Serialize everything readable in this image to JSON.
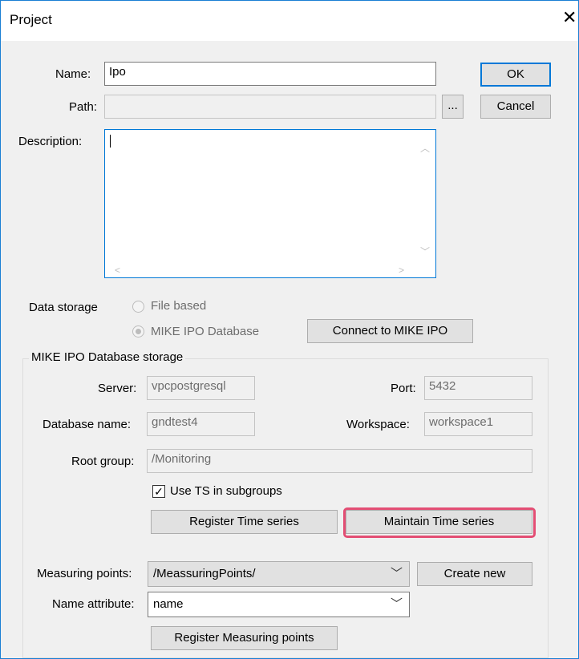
{
  "window": {
    "title": "Project",
    "close_glyph": "✕"
  },
  "fields": {
    "name_label": "Name:",
    "name_value": "Ipo",
    "path_label": "Path:",
    "path_value": "",
    "browse_label": "...",
    "description_label": "Description:",
    "description_value": ""
  },
  "buttons": {
    "ok": "OK",
    "cancel": "Cancel",
    "connect": "Connect to  MIKE IPO"
  },
  "storage": {
    "label": "Data storage",
    "option_file": "File based",
    "option_db": "MIKE IPO Database"
  },
  "db_group": {
    "title": "MIKE IPO Database storage",
    "server_label": "Server:",
    "server_value": "vpcpostgresql",
    "port_label": "Port:",
    "port_value": "5432",
    "dbname_label": "Database name:",
    "dbname_value": "gndtest4",
    "workspace_label": "Workspace:",
    "workspace_value": "workspace1",
    "root_label": "Root group:",
    "root_value": "/Monitoring",
    "use_ts_label": "Use TS in subgroups",
    "use_ts_checked": true,
    "register_ts": "Register Time series",
    "maintain_ts": "Maintain Time series",
    "measuring_label": "Measuring points:",
    "measuring_value": "/MeassuringPoints/",
    "create_new": "Create new",
    "name_attr_label": "Name attribute:",
    "name_attr_value": "name",
    "register_mp": "Register Measuring points"
  },
  "icons": {
    "check": "check-icon",
    "dropdown": "chevron-down-icon"
  },
  "colors": {
    "accent": "#0078d7",
    "highlight": "#e34e74"
  }
}
